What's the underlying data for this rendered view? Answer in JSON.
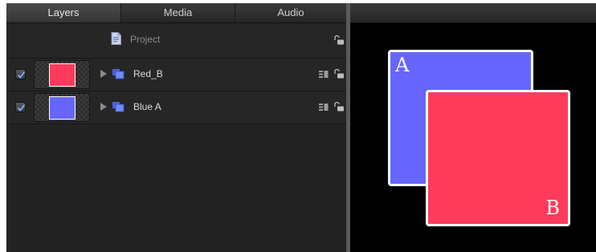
{
  "layers_panel": {
    "tabs": [
      {
        "label": "Layers",
        "active": true
      },
      {
        "label": "Media",
        "active": false
      },
      {
        "label": "Audio",
        "active": false
      }
    ],
    "project_row": {
      "label": "Project",
      "icon": "project-document-icon",
      "lock_icon": "unlocked-icon"
    },
    "layers": [
      {
        "name": "Red_B",
        "checked": true,
        "thumbnail_color": "#ff3b5c",
        "icon": "group-icon",
        "lock_icon": "unlocked-icon"
      },
      {
        "name": "Blue A",
        "checked": true,
        "thumbnail_color": "#6666ff",
        "icon": "group-icon",
        "lock_icon": "unlocked-icon"
      }
    ]
  },
  "canvas": {
    "background": "#000000",
    "shapes": [
      {
        "name": "square-a",
        "letter": "A",
        "fill": "#6666ff",
        "border": "#ffffff"
      },
      {
        "name": "square-b",
        "letter": "B",
        "fill": "#ff3b5c",
        "border": "#ffffff"
      }
    ]
  },
  "colors": {
    "panel_bg": "#232323",
    "row_bg": "#262626",
    "checkbox_accent": "#7fb0ff",
    "icon_blue": "#6f8cff"
  }
}
